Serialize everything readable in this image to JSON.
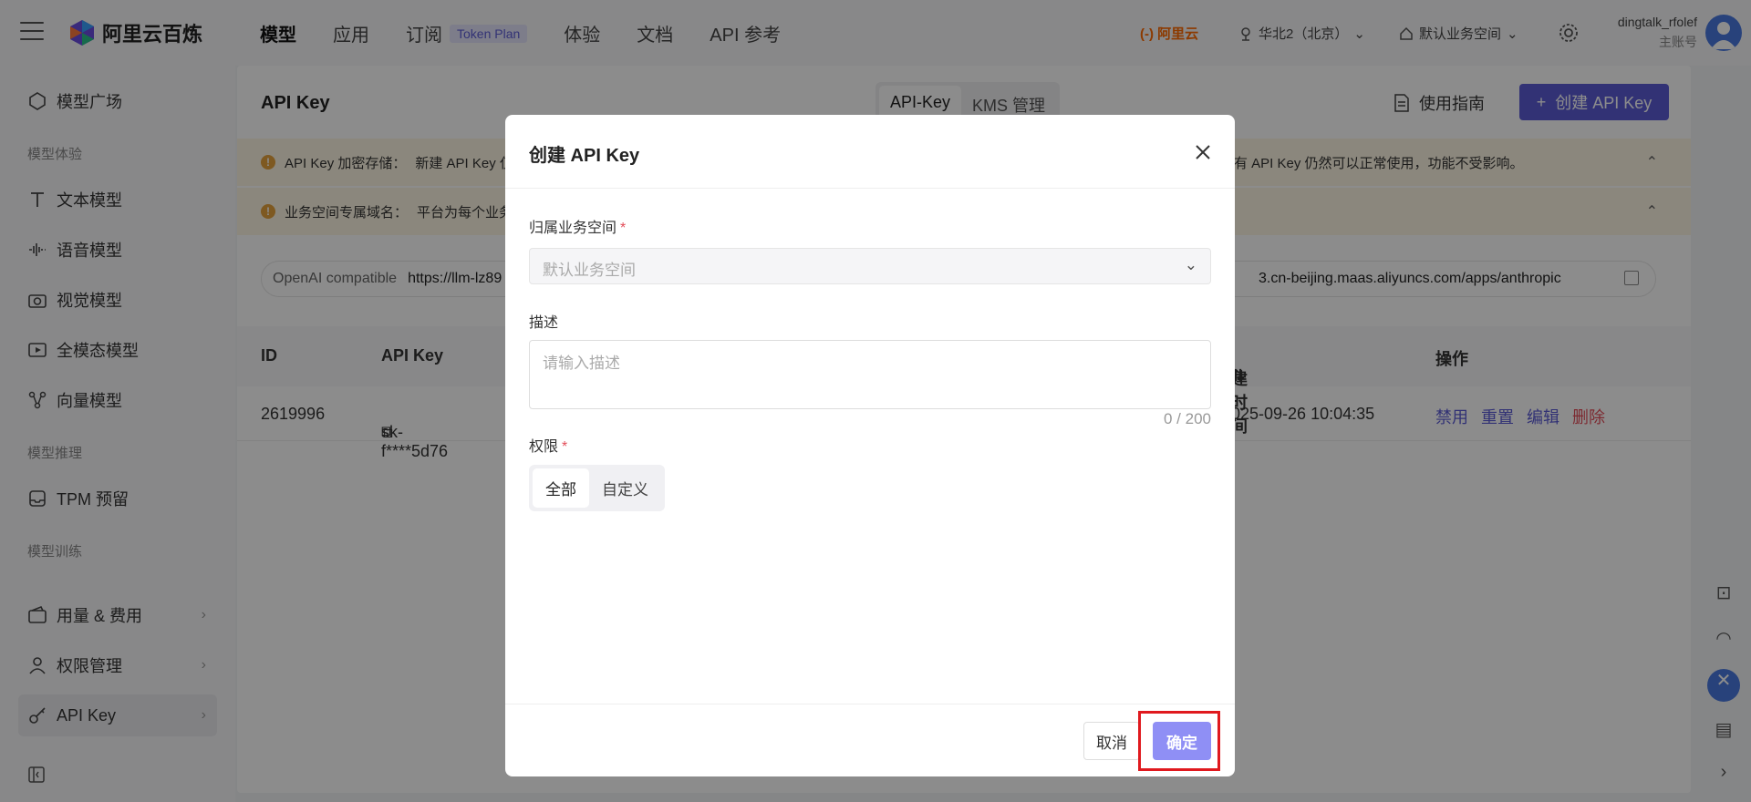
{
  "brand": {
    "name": "阿里云百炼"
  },
  "topnav": {
    "links": [
      "模型",
      "应用",
      "订阅",
      "体验",
      "文档",
      "API 参考"
    ],
    "token_badge": "Token Plan",
    "aliyun": "阿里云",
    "region": "华北2（北京）",
    "workspace": "默认业务空间",
    "username": "dingtalk_rfolef",
    "user_role": "主账号"
  },
  "sidebar": {
    "items": [
      {
        "label": "模型广场"
      },
      {
        "label": "文本模型"
      },
      {
        "label": "语音模型"
      },
      {
        "label": "视觉模型"
      },
      {
        "label": "全模态模型"
      },
      {
        "label": "向量模型"
      },
      {
        "label": "TPM 预留"
      },
      {
        "label": "用量 & 费用"
      },
      {
        "label": "权限管理"
      },
      {
        "label": "API Key"
      }
    ],
    "groups": [
      "模型体验",
      "模型推理",
      "模型训练"
    ]
  },
  "main": {
    "title": "API Key",
    "seg": [
      "API-Key",
      "KMS 管理"
    ],
    "guide": "使用指南",
    "create": "创建 API Key",
    "alert1_head": "API Key 加密存储：",
    "alert1_body": "新建 API Key 仅在",
    "alert1_tail": "有 API Key 仍然可以正常使用，功能不受影响。",
    "alert2_head": "业务空间专属域名：",
    "alert2_body": "平台为每个业务空",
    "url_label": "OpenAI compatible",
    "url_value": "https://llm-lz89",
    "url_tail": "3.cn-beijing.maas.aliyuncs.com/apps/anthropic",
    "table": {
      "headers": [
        "ID",
        "API Key",
        "建时间",
        "操作"
      ],
      "row": {
        "id": "2619996",
        "key": "sk-f****5d76",
        "time": "025-09-26 10:04:35",
        "actions": [
          "禁用",
          "重置",
          "编辑",
          "删除"
        ]
      }
    }
  },
  "modal": {
    "title": "创建 API Key",
    "workspace_label": "归属业务空间",
    "workspace_value": "默认业务空间",
    "desc_label": "描述",
    "desc_placeholder": "请输入描述",
    "counter": "0 / 200",
    "perm_label": "权限",
    "perm_options": [
      "全部",
      "自定义"
    ],
    "cancel": "取消",
    "ok": "确定"
  },
  "colors": {
    "accent": "#5b5bd6",
    "danger": "#e34d59",
    "warning": "#e6a23c",
    "highlight": "#e0191e"
  }
}
